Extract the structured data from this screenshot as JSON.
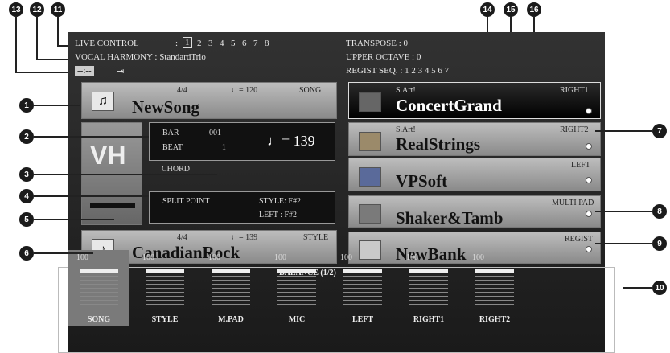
{
  "top": {
    "live_control": {
      "label": "LIVE CONTROL",
      "pages": [
        "1",
        "2",
        "3",
        "4",
        "5",
        "6",
        "7",
        "8"
      ]
    },
    "vocal_harmony": {
      "label": "VOCAL HARMONY : StandardTrio"
    },
    "time": "--:--",
    "transpose": "TRANSPOSE      : 0",
    "upper_octave": "UPPER OCTAVE : 0",
    "regist_seq": "REGIST SEQ.     : 1 2 3 4 5 6 7"
  },
  "song": {
    "meter": "4/4",
    "tempo": "♩= 120",
    "tag": "SONG",
    "name": "NewSong"
  },
  "bar_beat": {
    "bar_label": "BAR",
    "bar_value": "001",
    "beat_label": "BEAT",
    "beat_value": "1",
    "tempo_value": "♩= 139"
  },
  "chord": {
    "label": "CHORD"
  },
  "split": {
    "label": "SPLIT POINT",
    "style": "STYLE:  F#2",
    "left": "LEFT  :  F#2"
  },
  "style": {
    "meter": "4/4",
    "tempo": "♩= 139",
    "tag": "STYLE",
    "name": "CanadianRock"
  },
  "right1": {
    "sart": "S.Art!",
    "tag": "RIGHT1",
    "name": "ConcertGrand"
  },
  "right2": {
    "sart": "S.Art!",
    "tag": "RIGHT2",
    "name": "RealStrings"
  },
  "left": {
    "tag": "LEFT",
    "name": "VPSoft"
  },
  "multipad": {
    "tag": "MULTI PAD",
    "name": "Shaker&Tamb"
  },
  "regist": {
    "tag": "REGIST",
    "name": "NewBank"
  },
  "balance": {
    "title": "BALANCE (1/2)",
    "channels": [
      {
        "name": "SONG",
        "value": "100"
      },
      {
        "name": "STYLE",
        "value": "100"
      },
      {
        "name": "M.PAD",
        "value": "100"
      },
      {
        "name": "MIC",
        "value": "100"
      },
      {
        "name": "LEFT",
        "value": "100"
      },
      {
        "name": "RIGHT1",
        "value": "100"
      },
      {
        "name": "RIGHT2",
        "value": "100"
      }
    ]
  },
  "callouts": [
    "1",
    "2",
    "3",
    "4",
    "5",
    "6",
    "7",
    "8",
    "9",
    "10",
    "11",
    "12",
    "13",
    "14",
    "15",
    "16"
  ],
  "vh_logo": "VH"
}
